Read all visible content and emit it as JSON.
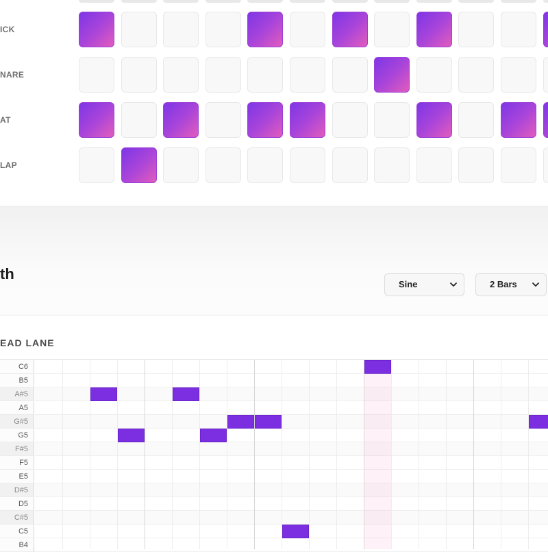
{
  "drum_machine": {
    "tracks": [
      {
        "label": "ICK",
        "steps": [
          1,
          0,
          0,
          0,
          1,
          0,
          1,
          0,
          1,
          0,
          0,
          1
        ]
      },
      {
        "label": "NARE",
        "steps": [
          0,
          0,
          0,
          0,
          0,
          0,
          0,
          1,
          0,
          0,
          0,
          0
        ]
      },
      {
        "label": "AT",
        "steps": [
          1,
          0,
          1,
          0,
          1,
          1,
          0,
          0,
          1,
          0,
          1,
          1
        ]
      },
      {
        "label": "LAP",
        "steps": [
          0,
          1,
          0,
          0,
          0,
          0,
          0,
          0,
          0,
          0,
          0,
          0
        ]
      }
    ]
  },
  "synth": {
    "title": "th",
    "waveform": {
      "selected": "Sine"
    },
    "length": {
      "selected": "2 Bars"
    }
  },
  "lead_lane": {
    "title": "EAD LANE",
    "keys": [
      {
        "label": "C6",
        "sharp": false
      },
      {
        "label": "B5",
        "sharp": false
      },
      {
        "label": "A#5",
        "sharp": true
      },
      {
        "label": "A5",
        "sharp": false
      },
      {
        "label": "G#5",
        "sharp": true
      },
      {
        "label": "G5",
        "sharp": false
      },
      {
        "label": "F#5",
        "sharp": true
      },
      {
        "label": "F5",
        "sharp": false
      },
      {
        "label": "E5",
        "sharp": false
      },
      {
        "label": "D#5",
        "sharp": true
      },
      {
        "label": "D5",
        "sharp": false
      },
      {
        "label": "C#5",
        "sharp": true
      },
      {
        "label": "C5",
        "sharp": false
      },
      {
        "label": "B4",
        "sharp": false
      }
    ],
    "notes": [
      {
        "pitch": "A#5",
        "step": 2
      },
      {
        "pitch": "G5",
        "step": 3
      },
      {
        "pitch": "A#5",
        "step": 5
      },
      {
        "pitch": "G5",
        "step": 6
      },
      {
        "pitch": "G#5",
        "step": 7
      },
      {
        "pitch": "G#5",
        "step": 8
      },
      {
        "pitch": "C5",
        "step": 9
      },
      {
        "pitch": "C6",
        "step": 12
      },
      {
        "pitch": "G#5",
        "step": 18
      }
    ],
    "playhead_step": 12
  }
}
